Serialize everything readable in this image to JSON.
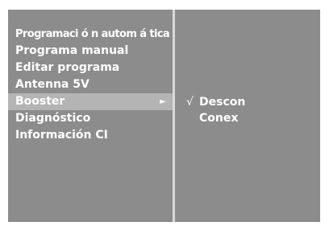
{
  "menu": {
    "items": [
      {
        "label": "Programaci ó n autom á tica"
      },
      {
        "label": "Programa manual"
      },
      {
        "label": "Editar programa"
      },
      {
        "label": "Antenna 5V"
      },
      {
        "label": "Booster",
        "submenu_arrow": "►"
      },
      {
        "label": "Diagnóstico"
      },
      {
        "label": "Información CI"
      }
    ],
    "selected_item": "Booster"
  },
  "submenu": {
    "check_mark": "√",
    "options": [
      {
        "label": "Descon"
      },
      {
        "label": "Conex"
      }
    ],
    "selected_option": "Descon"
  },
  "colors": {
    "panel_background": "#8c8c8c",
    "highlight_background": "#b4b4b4",
    "divider": "#d9d9d9",
    "text": "#ffffff"
  },
  "icons": {
    "submenu_arrow": "triangle-right-icon",
    "check": "checkmark-icon"
  }
}
